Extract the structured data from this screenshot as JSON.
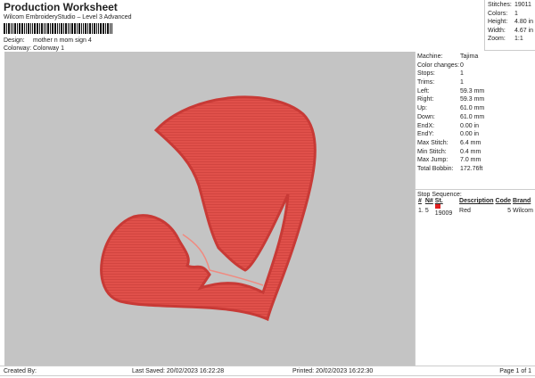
{
  "header": {
    "title": "Production Worksheet",
    "subtitle": "Wilcom EmbroideryStudio – Level 3 Advanced",
    "design_label": "Design:",
    "design": "mother n mom sign 4",
    "colorway_label": "Colorway:",
    "colorway": "Colorway 1"
  },
  "stats": [
    {
      "k": "Stitches:",
      "v": "19011"
    },
    {
      "k": "Colors:",
      "v": "1"
    },
    {
      "k": "Height:",
      "v": "4.80 in"
    },
    {
      "k": "Width:",
      "v": "4.67 in"
    },
    {
      "k": "Zoom:",
      "v": "1:1"
    }
  ],
  "details": [
    {
      "k": "Machine:",
      "v": "Tajima"
    },
    {
      "k": "Color changes:",
      "v": "0"
    },
    {
      "k": "Stops:",
      "v": "1"
    },
    {
      "k": "Trims:",
      "v": "1"
    },
    {
      "k": "Left:",
      "v": "59.3 mm"
    },
    {
      "k": "Right:",
      "v": "59.3 mm"
    },
    {
      "k": "Up:",
      "v": "61.0 mm"
    },
    {
      "k": "Down:",
      "v": "61.0 mm"
    },
    {
      "k": "EndX:",
      "v": "0.00 in"
    },
    {
      "k": "EndY:",
      "v": "0.00 in"
    },
    {
      "k": "Max Stitch:",
      "v": "6.4 mm"
    },
    {
      "k": "Min Stitch:",
      "v": "0.4 mm"
    },
    {
      "k": "Max Jump:",
      "v": "7.0 mm"
    },
    {
      "k": "Total Bobbin:",
      "v": "172.76ft"
    }
  ],
  "stop_sequence": {
    "title": "Stop Sequence:",
    "headers": [
      "#",
      "N#",
      "St.",
      "Description",
      "Code",
      "Brand"
    ],
    "rows": [
      {
        "num": "1.",
        "n": "5",
        "color": "#e02020",
        "st": "19009",
        "desc": "Red",
        "code": "5",
        "brand": "Wilcom"
      }
    ]
  },
  "footer": {
    "created": "Created By:",
    "saved": "Last Saved: 20/02/2023 16:22:28",
    "printed": "Printed: 20/02/2023 16:22:30",
    "page": "Page 1 of 1"
  },
  "colors": {
    "thread": "#e0504a",
    "canvas": "#c4c4c4"
  }
}
